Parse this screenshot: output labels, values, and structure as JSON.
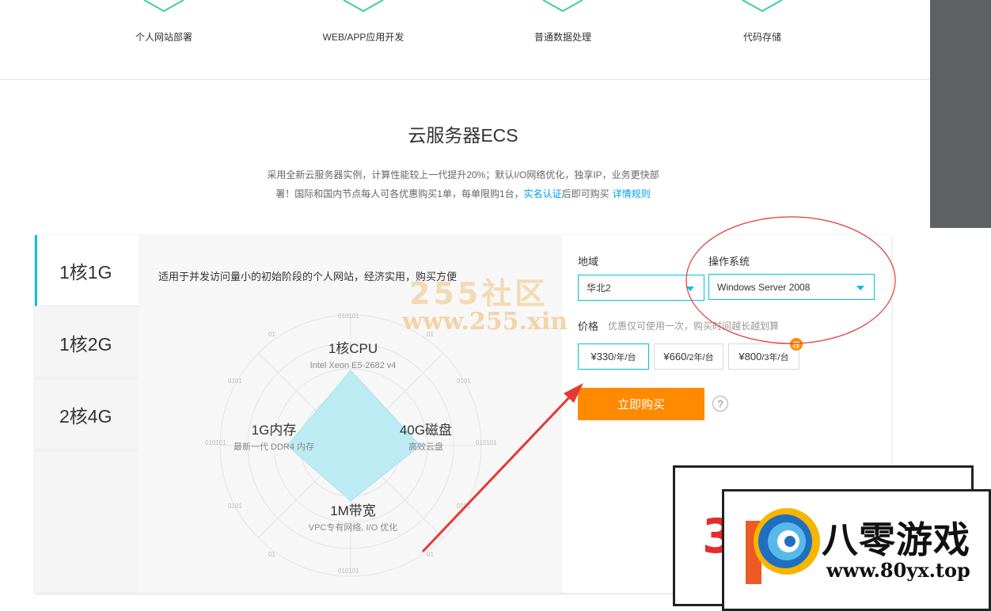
{
  "scenarios": [
    {
      "label": "个人网站部署"
    },
    {
      "label": "WEB/APP应用开发"
    },
    {
      "label": "普通数据处理"
    },
    {
      "label": "代码存储"
    }
  ],
  "section": {
    "title": "云服务器ECS",
    "desc_line1": "采用全新云服务器实例，计算性能较上一代提升20%；默认I/O网络优化，独享IP，业务更快部",
    "desc_line2": "署！国际和国内节点每人可各优惠购买1单，每单限购1台，",
    "realname_link": "实名认证",
    "desc_after_link": "后即可购买",
    "rules_link": "详情规则"
  },
  "tabs": [
    {
      "label": "1核1G",
      "active": true
    },
    {
      "label": "1核2G",
      "active": false
    },
    {
      "label": "2核4G",
      "active": false
    }
  ],
  "product": {
    "tagline": "适用于并发访问量小的初始阶段的个人网站，经济实用，购买方便",
    "radar": {
      "cpu_title": "1核CPU",
      "cpu_sub": "Intel Xeon E5-2682 v4",
      "mem_title": "1G内存",
      "mem_sub": "最新一代 DDR4 内存",
      "disk_title": "40G磁盘",
      "disk_sub": "高效云盘",
      "bw_title": "1M带宽",
      "bw_sub": "VPC专有网络, I/O 优化",
      "deco": [
        "010101",
        "01",
        "0101",
        "010101",
        "0101",
        "01",
        "010101",
        "01",
        "0101",
        "010101",
        "0101",
        "01"
      ]
    }
  },
  "config": {
    "region_label": "地域",
    "region_value": "华北2",
    "os_label": "操作系统",
    "os_value": "Windows Server 2008",
    "price_label": "价格",
    "price_note": "优惠仅可使用一次，购买时间越长越划算",
    "prices": [
      {
        "amount": "¥330",
        "unit": "/年/台",
        "active": true
      },
      {
        "amount": "¥660",
        "unit": "/2年/台",
        "active": false
      },
      {
        "amount": "¥800",
        "unit": "/3年/台",
        "active": false
      }
    ],
    "badge": "荐",
    "buy_label": "立即购买",
    "help": "?"
  },
  "watermark": {
    "line1": "255社区",
    "line2": "www.255.xin"
  },
  "logo": {
    "digit": "3",
    "name": "八零游戏",
    "url": "www.80yx.top"
  },
  "colors": {
    "accent": "#00c1de",
    "buy": "#ff8a00",
    "annotation": "#e53935",
    "radar_fill": "#bdebf3"
  }
}
